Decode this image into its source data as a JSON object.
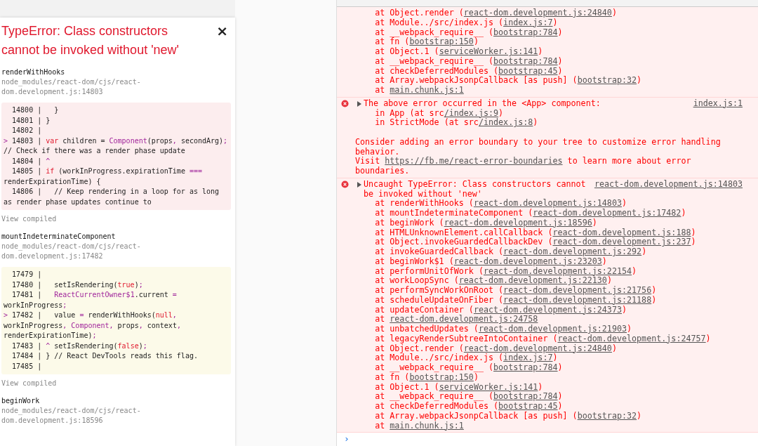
{
  "overlay": {
    "title": "TypeError: Class constructors cannot be invoked without 'new'",
    "close": "×",
    "frames": [
      {
        "function": "renderWithHooks",
        "file": "node_modules/react-dom/cjs/react-dom.development.js:14803",
        "kind": "error",
        "view_compiled": "View compiled",
        "code": [
          [
            {
              "text": "  14800 |   }"
            }
          ],
          [
            {
              "text": "  14801 | }"
            }
          ],
          [
            {
              "text": "  14802 |"
            }
          ],
          [
            {
              "text": "> ",
              "kind": "mark"
            },
            {
              "text": "14803 | "
            },
            {
              "text": "var",
              "kind": "keyword"
            },
            {
              "text": " children = "
            },
            {
              "text": "Component",
              "kind": "name"
            },
            {
              "text": "(props"
            },
            {
              "text": ",",
              "kind": "name"
            },
            {
              "text": " secondArg)"
            },
            {
              "text": ";",
              "kind": "name"
            },
            {
              "text": " // Check if there was a render phase update"
            }
          ],
          [
            {
              "text": "  14804 | "
            },
            {
              "text": "^",
              "kind": "name"
            }
          ],
          [
            {
              "text": "  14805 | "
            },
            {
              "text": "if",
              "kind": "keyword"
            },
            {
              "text": " (workInProgress.expirationTime "
            },
            {
              "text": "===",
              "kind": "name"
            },
            {
              "text": " renderExpirationTime) {"
            }
          ],
          [
            {
              "text": "  14806 |   // Keep rendering in a loop for as long as render phase updates continue to"
            }
          ]
        ]
      },
      {
        "function": "mountIndeterminateComponent",
        "file": "node_modules/react-dom/cjs/react-dom.development.js:17482",
        "kind": "neutral",
        "view_compiled": "View compiled",
        "code": [
          [
            {
              "text": "  17479 |"
            }
          ],
          [
            {
              "text": "  17480 |   setIsRendering("
            },
            {
              "text": "true",
              "kind": "keyword"
            },
            {
              "text": ")"
            },
            {
              "text": ";",
              "kind": "name"
            }
          ],
          [
            {
              "text": "  17481 |   "
            },
            {
              "text": "ReactCurrentOwner$1",
              "kind": "name"
            },
            {
              "text": ".current "
            },
            {
              "text": "=",
              "kind": "name"
            },
            {
              "text": " workInProgress"
            },
            {
              "text": ";",
              "kind": "name"
            }
          ],
          [
            {
              "text": "> ",
              "kind": "mark"
            },
            {
              "text": "17482 |   value "
            },
            {
              "text": "=",
              "kind": "name"
            },
            {
              "text": " renderWithHooks("
            },
            {
              "text": "null",
              "kind": "keyword"
            },
            {
              "text": ",",
              "kind": "name"
            },
            {
              "text": " workInProgress"
            },
            {
              "text": ",",
              "kind": "name"
            },
            {
              "text": " Component",
              "kind": "name"
            },
            {
              "text": ",",
              "kind": "name"
            },
            {
              "text": " props"
            },
            {
              "text": ",",
              "kind": "name"
            },
            {
              "text": " context"
            },
            {
              "text": ",",
              "kind": "name"
            },
            {
              "text": " renderExpirationTime)"
            },
            {
              "text": ";",
              "kind": "name"
            }
          ],
          [
            {
              "text": "  17483 | "
            },
            {
              "text": "^",
              "kind": "name"
            },
            {
              "text": " setIsRendering("
            },
            {
              "text": "false",
              "kind": "keyword"
            },
            {
              "text": ")"
            },
            {
              "text": ";",
              "kind": "name"
            }
          ],
          [
            {
              "text": "  17484 | } // React DevTools reads this flag."
            }
          ],
          [
            {
              "text": "  17485 |"
            }
          ]
        ]
      },
      {
        "function": "beginWork",
        "file": "node_modules/react-dom/cjs/react-dom.development.js:18596"
      }
    ]
  },
  "console": {
    "messages": [
      {
        "kind": "stack",
        "lines": [
          {
            "before": "at Object.render (",
            "link": "react-dom.development.js:24840",
            "after": ")"
          },
          {
            "before": "at Module../src/index.js (",
            "link": "index.js:7",
            "after": ")"
          },
          {
            "before": "at __webpack_require__ (",
            "link": "bootstrap:784",
            "after": ")"
          },
          {
            "before": "at fn (",
            "link": "bootstrap:150",
            "after": ")"
          },
          {
            "before": "at Object.1 (",
            "link": "serviceWorker.js:141",
            "after": ")"
          },
          {
            "before": "at __webpack_require__ (",
            "link": "bootstrap:784",
            "after": ")"
          },
          {
            "before": "at checkDeferredModules (",
            "link": "bootstrap:45",
            "after": ")"
          },
          {
            "before": "at Array.webpackJsonpCallback [as push] (",
            "link": "bootstrap:32",
            "after": ")"
          },
          {
            "before": "at ",
            "link": "main.chunk.js:1"
          }
        ]
      },
      {
        "kind": "error",
        "expanded": false,
        "header": "The above error occurred in the <App> component:",
        "source": "index.js:1",
        "lines": [
          {
            "before": "in App (at src",
            "link": "/index.js:9",
            "after": ")"
          },
          {
            "before": "in StrictMode (at src",
            "link": "/index.js:8",
            "after": ")"
          }
        ],
        "note": "Consider adding an error boundary to your tree to customize error handling behavior.",
        "visit": {
          "before": "Visit ",
          "link": "https://fb.me/react-error-boundaries",
          "after": " to learn more about error boundaries."
        }
      },
      {
        "kind": "error",
        "expanded": false,
        "header": "Uncaught TypeError: Class constructors cannot be invoked without 'new'",
        "source": "react-dom.development.js:14803",
        "lines": [
          {
            "before": "at renderWithHooks (",
            "link": "react-dom.development.js:14803",
            "after": ")"
          },
          {
            "before": "at mountIndeterminateComponent (",
            "link": "react-dom.development.js:17482",
            "after": ")"
          },
          {
            "before": "at beginWork (",
            "link": "react-dom.development.js:18596",
            "after": ")"
          },
          {
            "before": "at HTMLUnknownElement.callCallback (",
            "link": "react-dom.development.js:188",
            "after": ")"
          },
          {
            "before": "at Object.invokeGuardedCallbackDev (",
            "link": "react-dom.development.js:237",
            "after": ")"
          },
          {
            "before": "at invokeGuardedCallback (",
            "link": "react-dom.development.js:292",
            "after": ")"
          },
          {
            "before": "at beginWork$1 (",
            "link": "react-dom.development.js:23203",
            "after": ")"
          },
          {
            "before": "at performUnitOfWork (",
            "link": "react-dom.development.js:22154",
            "after": ")"
          },
          {
            "before": "at workLoopSync (",
            "link": "react-dom.development.js:22130",
            "after": ")"
          },
          {
            "before": "at performSyncWorkOnRoot (",
            "link": "react-dom.development.js:21756",
            "after": ")"
          },
          {
            "before": "at scheduleUpdateOnFiber (",
            "link": "react-dom.development.js:21188",
            "after": ")"
          },
          {
            "before": "at updateContainer (",
            "link": "react-dom.development.js:24373",
            "after": ")"
          },
          {
            "before": "at ",
            "link": "react-dom.development.js:24758"
          },
          {
            "before": "at unbatchedUpdates (",
            "link": "react-dom.development.js:21903",
            "after": ")"
          },
          {
            "before": "at legacyRenderSubtreeIntoContainer (",
            "link": "react-dom.development.js:24757",
            "after": ")"
          },
          {
            "before": "at Object.render (",
            "link": "react-dom.development.js:24840",
            "after": ")"
          },
          {
            "before": "at Module../src/index.js (",
            "link": "index.js:7",
            "after": ")"
          },
          {
            "before": "at __webpack_require__ (",
            "link": "bootstrap:784",
            "after": ")"
          },
          {
            "before": "at fn (",
            "link": "bootstrap:150",
            "after": ")"
          },
          {
            "before": "at Object.1 (",
            "link": "serviceWorker.js:141",
            "after": ")"
          },
          {
            "before": "at __webpack_require__ (",
            "link": "bootstrap:784",
            "after": ")"
          },
          {
            "before": "at checkDeferredModules (",
            "link": "bootstrap:45",
            "after": ")"
          },
          {
            "before": "at Array.webpackJsonpCallback [as push] (",
            "link": "bootstrap:32",
            "after": ")"
          },
          {
            "before": "at ",
            "link": "main.chunk.js:1"
          }
        ]
      }
    ],
    "prompt": "›"
  }
}
